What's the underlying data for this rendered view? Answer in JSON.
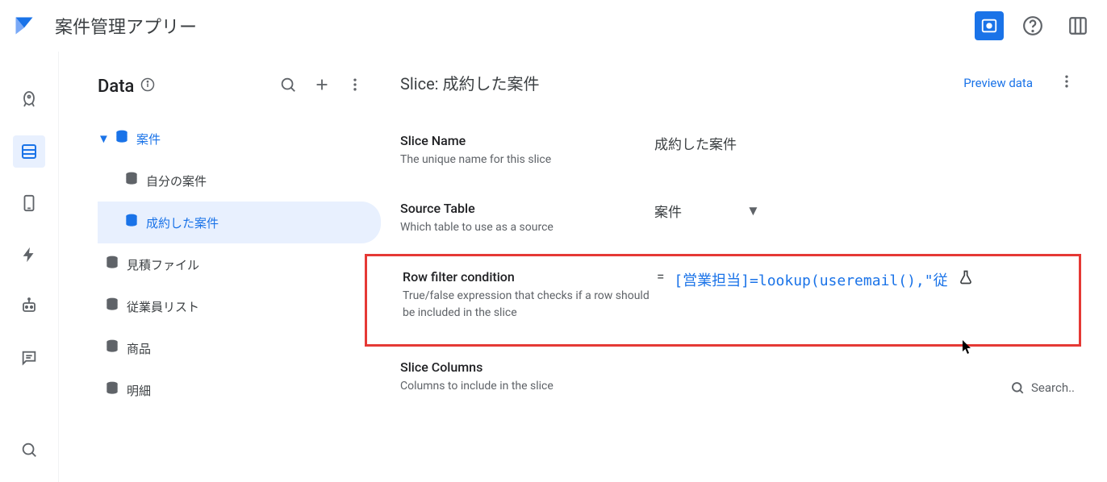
{
  "topbar": {
    "app_title": "案件管理アプリー"
  },
  "data_panel": {
    "title": "Data",
    "tree": {
      "parent": "案件",
      "children": [
        "自分の案件",
        "成約した案件",
        "見積ファイル",
        "従業員リスト",
        "商品",
        "明細"
      ]
    }
  },
  "detail": {
    "header_prefix": "Slice: ",
    "header_value": "成約した案件",
    "preview_link": "Preview data",
    "fields": {
      "slice_name": {
        "label": "Slice Name",
        "sublabel": "The unique name for this slice",
        "value": "成約した案件"
      },
      "source_table": {
        "label": "Source Table",
        "sublabel": "Which table to use as a source",
        "value": "案件"
      },
      "row_filter": {
        "label": "Row filter condition",
        "sublabel": "True/false expression that checks if a row should be included in the slice",
        "eq": "=",
        "formula": "[営業担当]=lookup(useremail(),\"従"
      },
      "slice_columns": {
        "label": "Slice Columns",
        "sublabel": "Columns to include in the slice",
        "search_placeholder": "Search.."
      }
    }
  }
}
